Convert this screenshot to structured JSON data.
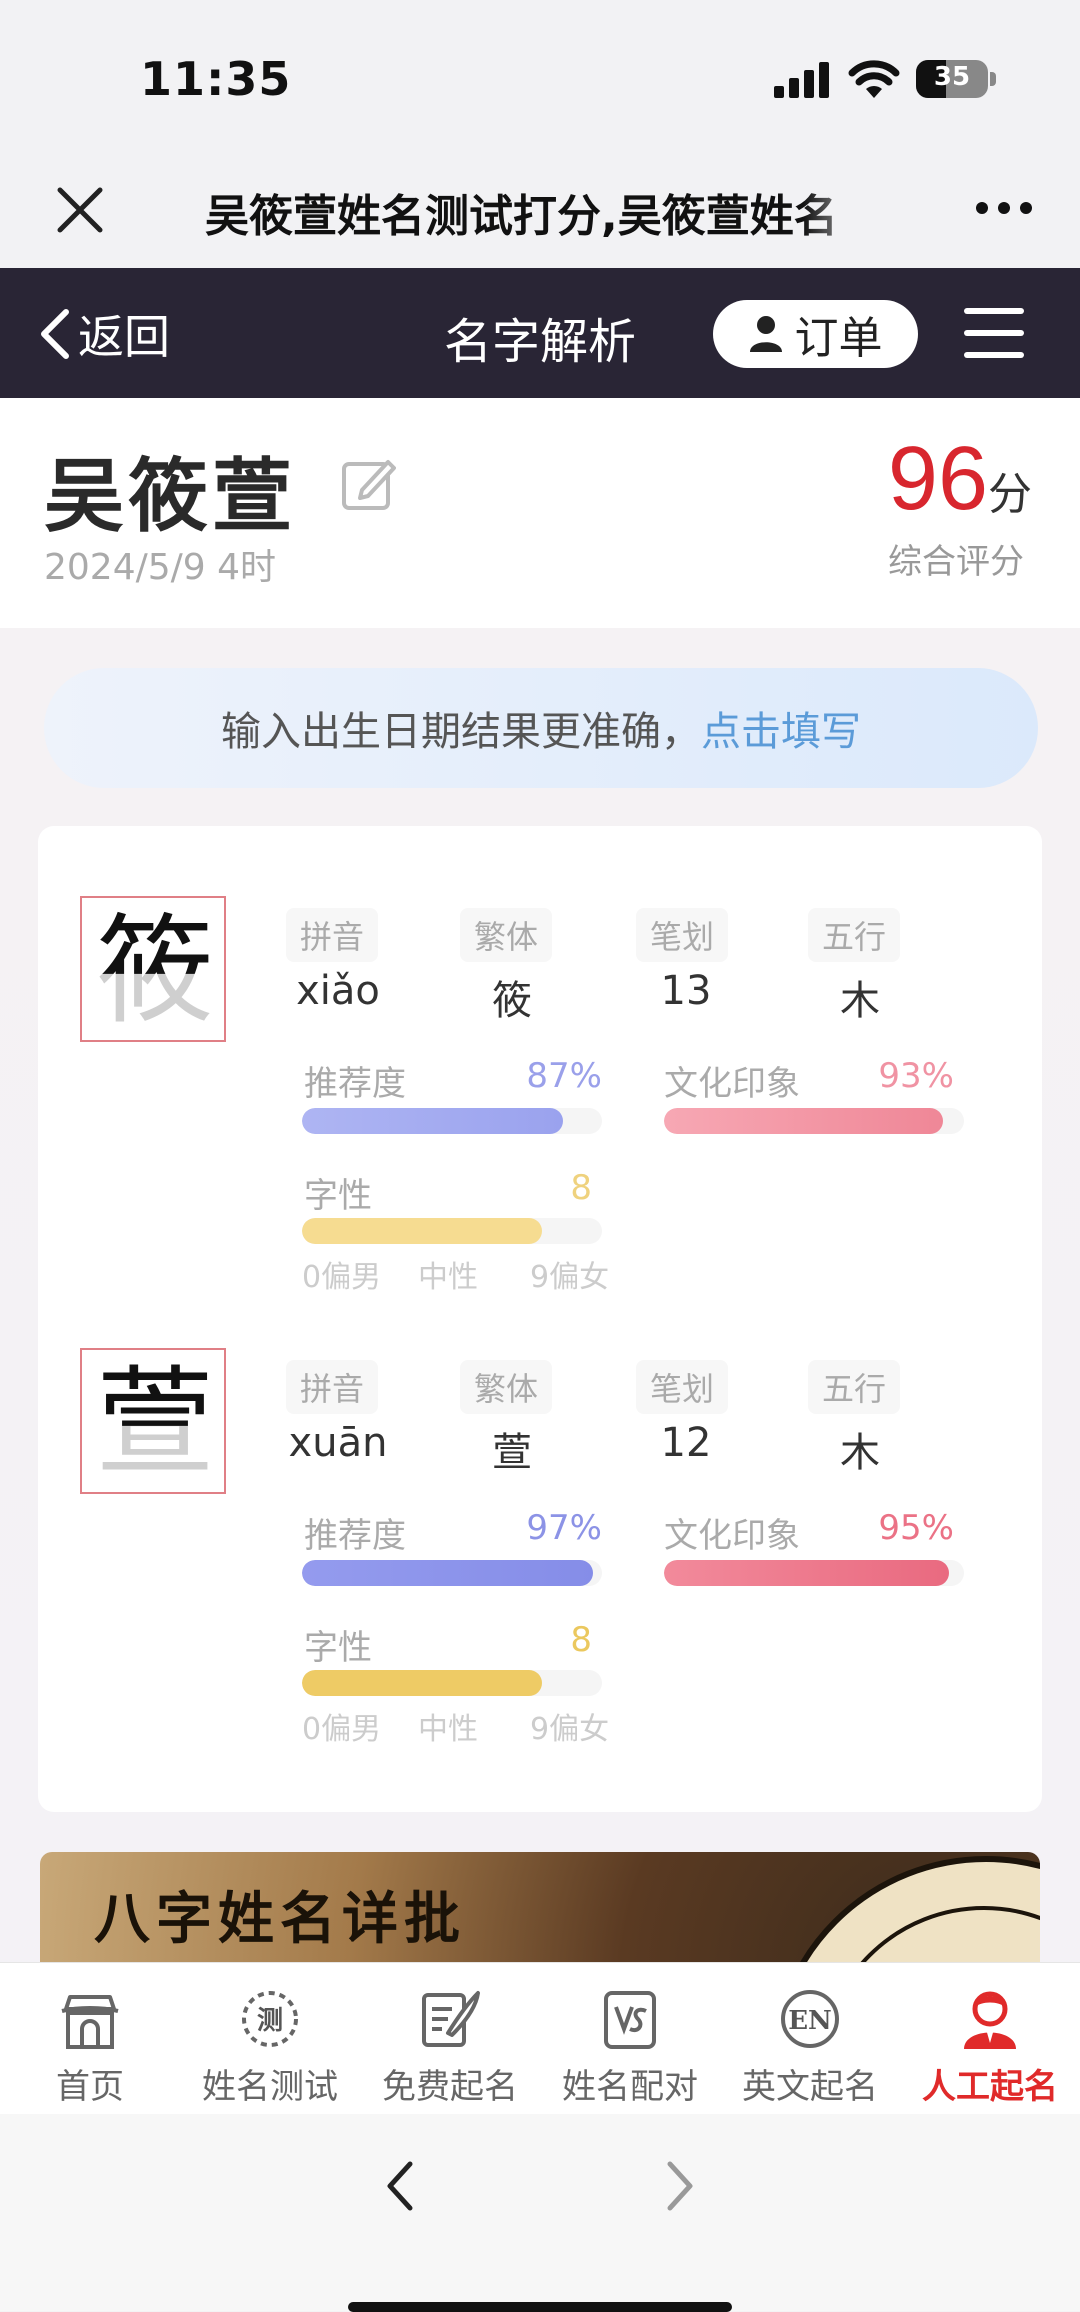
{
  "status_bar": {
    "time": "11:35",
    "battery": "35"
  },
  "browser": {
    "title": "吴筱萱姓名测试打分,吴筱萱姓名"
  },
  "header": {
    "back_label": "返回",
    "title": "名字解析",
    "order_label": "订单"
  },
  "name": {
    "full": "吴筱萱",
    "birth": "2024/5/9 4时",
    "score": "96",
    "score_unit": "分",
    "score_label": "综合评分"
  },
  "tip": {
    "text": "输入出生日期结果更准确，",
    "link": "点击填写"
  },
  "attr_labels": {
    "pinyin": "拼音",
    "trad": "繁体",
    "strokes": "笔划",
    "wuxing": "五行"
  },
  "meter_labels": {
    "recommend": "推荐度",
    "culture": "文化印象",
    "gender": "字性"
  },
  "scale": {
    "male": "0偏男",
    "neutral": "中性",
    "female": "9偏女"
  },
  "chars": [
    {
      "char": "筱",
      "pinyin": "xiǎo",
      "traditional": "筱",
      "strokes": "13",
      "wuxing": "木",
      "recommend": "87%",
      "recommend_value": 0.87,
      "culture": "93%",
      "culture_value": 0.93,
      "gender": "8",
      "gender_value": 0.8
    },
    {
      "char": "萱",
      "pinyin": "xuān",
      "traditional": "萱",
      "strokes": "12",
      "wuxing": "木",
      "recommend": "97%",
      "recommend_value": 0.97,
      "culture": "95%",
      "culture_value": 0.95,
      "gender": "8",
      "gender_value": 0.8
    }
  ],
  "banner": {
    "text": "八字姓名详批"
  },
  "tabbar": [
    {
      "label": "首页",
      "icon": "home-icon"
    },
    {
      "label": "姓名测试",
      "icon": "name-test-icon"
    },
    {
      "label": "免费起名",
      "icon": "free-naming-icon"
    },
    {
      "label": "姓名配对",
      "icon": "name-match-icon"
    },
    {
      "label": "英文起名",
      "icon": "english-name-icon"
    },
    {
      "label": "人工起名",
      "icon": "manual-naming-icon"
    }
  ],
  "colors": {
    "accent_red": "#d8262e",
    "header_bg": "#292535",
    "recommend_bar": "#8f96e8",
    "culture_bar": "#ef7a8c",
    "gender_bar": "#f0cf6e"
  }
}
